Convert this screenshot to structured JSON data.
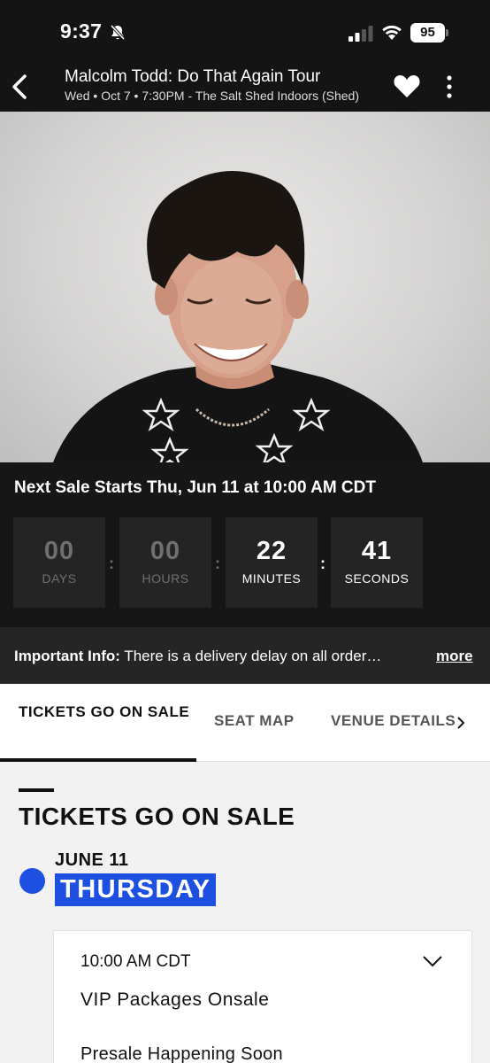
{
  "status_bar": {
    "time": "9:37",
    "battery": "95",
    "icons": [
      "bell-slash-icon",
      "cellular-signal-icon",
      "wifi-icon",
      "battery-icon"
    ]
  },
  "header": {
    "title": "Malcolm Todd: Do That Again Tour",
    "subtitle": "Wed • Oct 7 • 7:30PM - The Salt Shed Indoors (Shed)",
    "icons": [
      "chevron-left-icon",
      "heart-icon",
      "more-vertical-icon"
    ]
  },
  "sale": {
    "next_sale": "Next Sale Starts Thu, Jun 11 at 10:00 AM CDT",
    "countdown": [
      {
        "value": "00",
        "unit": "DAYS"
      },
      {
        "value": "00",
        "unit": "HOURS"
      },
      {
        "value": "22",
        "unit": "MINUTES"
      },
      {
        "value": "41",
        "unit": "SECONDS"
      }
    ]
  },
  "info": {
    "label": "Important Info:",
    "text": " There is a delivery delay on all order…",
    "more": "more"
  },
  "tabs": [
    "TICKETS GO ON SALE",
    "SEAT MAP",
    "VENUE DETAILS"
  ],
  "section": {
    "title": "TICKETS GO ON SALE",
    "date": "JUNE 11",
    "day": "THURSDAY"
  },
  "card": {
    "time": "10:00 AM CDT",
    "title": "VIP Packages Onsale",
    "line": "Presale Happening Soon"
  },
  "colors": {
    "header_bg": "#141414",
    "accent_blue": "#1d4fe0",
    "countdown_box": "#242424"
  }
}
